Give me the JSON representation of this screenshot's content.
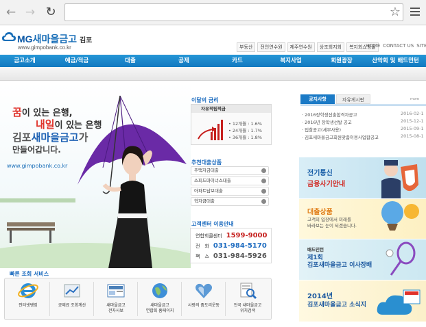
{
  "browser": {
    "url": ""
  },
  "header": {
    "logo_mg": "MG",
    "logo_name": "새마을금고",
    "logo_branch": "김포",
    "logo_url": "www.gimpobank.co.kr",
    "top_links": [
      "부동산",
      "전인연수원",
      "제주연수원",
      "상조회지회",
      "복지회쇼핑몰"
    ],
    "util_links": [
      "HOME",
      "CONTACT US",
      "SITEMAP"
    ]
  },
  "gnb": [
    "금고소개",
    "예금/적금",
    "대출",
    "공제",
    "카드",
    "복지사업",
    "회원광장",
    "산악회 및 배드민턴"
  ],
  "hero": {
    "line1_a": "꿈",
    "line1_b": "이 있는 은행,",
    "line2_a": "내일",
    "line2_b": "이 있는 은행",
    "line3_a": "김포",
    "line3_b": "새마을금고",
    "line3_c": "가",
    "line4": "만들어갑니다.",
    "url": "www.gimpobank.co.kr"
  },
  "rates": {
    "title": "이달의 금리",
    "product": "자유적립적금",
    "rows": [
      {
        "label": "12개월",
        "value": "1.6%"
      },
      {
        "label": "24개월",
        "value": "1.7%"
      },
      {
        "label": "36개월",
        "value": "1.8%"
      }
    ]
  },
  "loans": {
    "title": "추천대출상품",
    "items": [
      "주택자금대출",
      "스피드마이너스대출",
      "아파트담보대출",
      "학자금대출"
    ]
  },
  "callcenter": {
    "title": "고객센터 이용안내",
    "rows": [
      {
        "label": "연합회콜센터",
        "number": "1599-9000"
      },
      {
        "label": "전　화",
        "number": "031-984-5170"
      },
      {
        "label": "팩　스",
        "number": "031-984-5926"
      }
    ]
  },
  "notice": {
    "tabs": [
      "공지사항",
      "자유게시판"
    ],
    "more": "more",
    "items": [
      {
        "title": "2016장학생선출합격자공고",
        "date": "2016-02-1"
      },
      {
        "title": "2016년 장학생선발 공고",
        "date": "2015-12-1"
      },
      {
        "title": "입찰공고(세무사용)",
        "date": "2015-09-1"
      },
      {
        "title": "김포새마을금고회원맞춤이용사업합공고",
        "date": "2015-08-1"
      }
    ]
  },
  "banners": [
    {
      "title": "전기통신",
      "sub": "금융사기안내"
    },
    {
      "title": "대출상품",
      "sub": "고객의 입장에서 미래를\n바라보는 눈이 되겠습니다."
    },
    {
      "title": "배드민턴",
      "sub": "제1회\n김포새마을금고 이사장배"
    },
    {
      "title": "2014년",
      "sub": "김포새마을금고 소식지"
    }
  ],
  "quick": {
    "title": "빠른 조회 서비스",
    "items": [
      {
        "label": "인터넷뱅킹",
        "icon": "ie-icon"
      },
      {
        "label": "공제료 조회계산",
        "icon": "chart-icon"
      },
      {
        "label": "새마을금고\n전자사보",
        "icon": "newsletter-icon"
      },
      {
        "label": "새마을금고\n연합회 홈페이지",
        "icon": "globe-icon"
      },
      {
        "label": "사랑의 좀도리운동",
        "icon": "heart-icon"
      },
      {
        "label": "전국 새마을금고\n위치검색",
        "icon": "location-search-icon"
      }
    ]
  },
  "colors": {
    "brand_blue": "#1279c0",
    "accent_red": "#c6201e",
    "umbrella_purple": "#6a2aa6"
  }
}
